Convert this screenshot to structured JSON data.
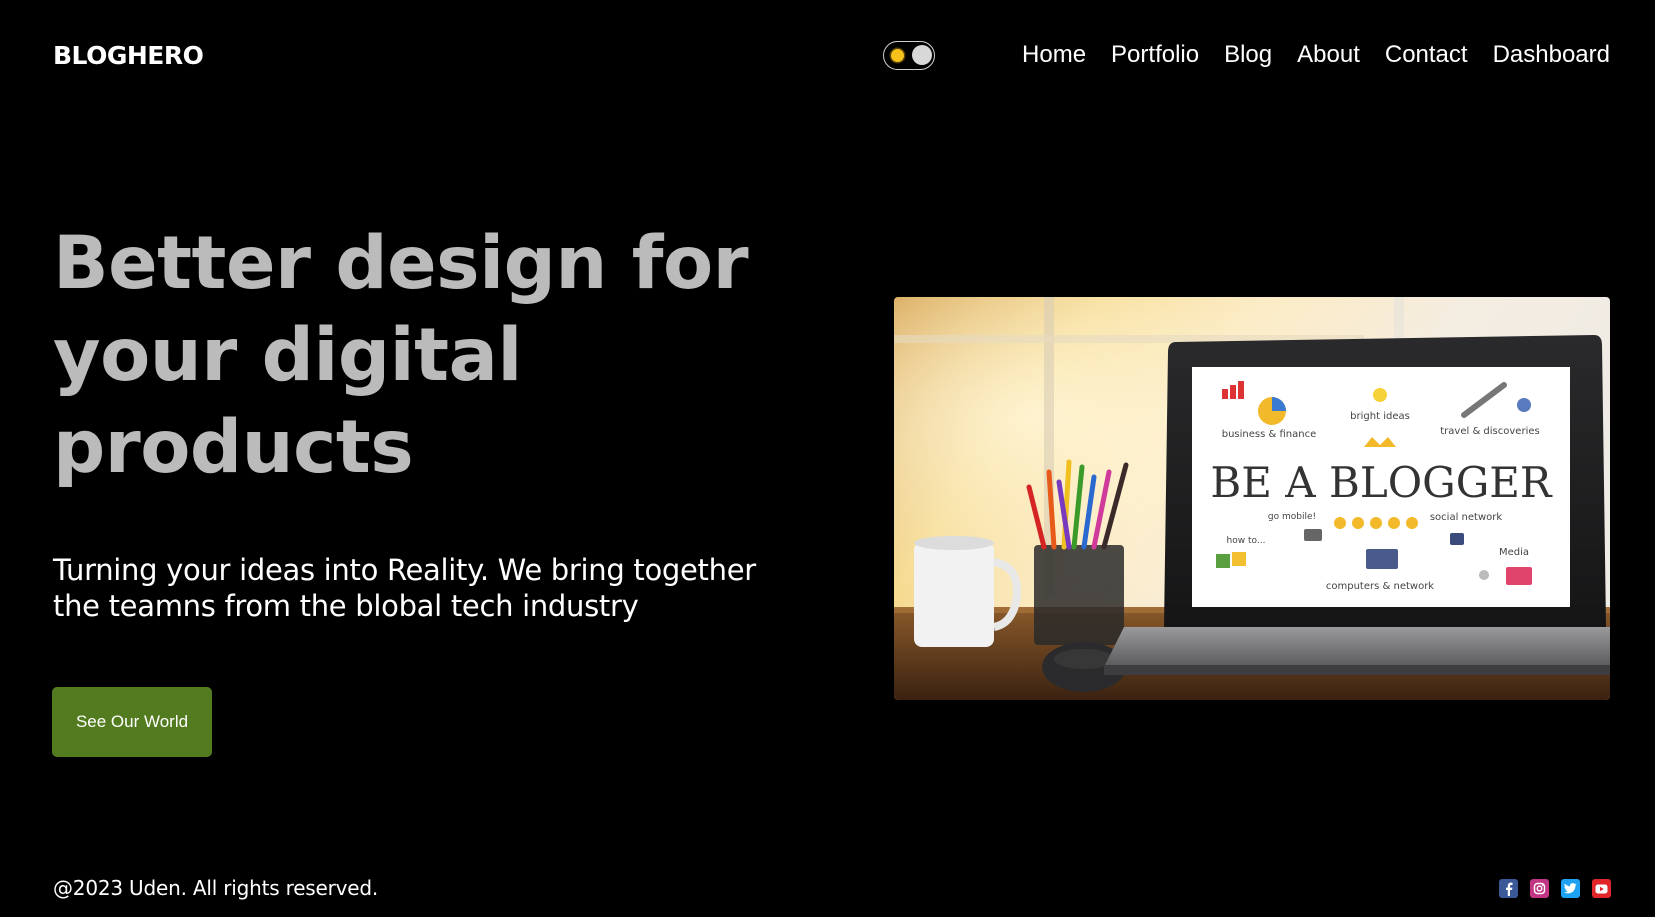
{
  "header": {
    "logo": "BLOGHERO",
    "nav": [
      "Home",
      "Portfolio",
      "Blog",
      "About",
      "Contact",
      "Dashboard"
    ]
  },
  "theme_toggle": {
    "icon": "sun-icon",
    "state": "dark"
  },
  "hero": {
    "title": "Better design for your digital products",
    "subtitle": "Turning your ideas into Reality. We bring together the teamns from the blobal tech industry",
    "cta_label": "See Our World",
    "image": {
      "headline": "BE A BLOGGER",
      "labels": {
        "business": "business & finance",
        "ideas": "bright ideas",
        "travel": "travel & discoveries",
        "mobile": "go mobile!",
        "social": "social network",
        "howto": "how to...",
        "computers": "computers & network",
        "media": "Media"
      }
    }
  },
  "footer": {
    "copyright": "@2023 Uden. All rights reserved.",
    "socials": [
      {
        "name": "facebook-icon",
        "color": "#3b5998"
      },
      {
        "name": "instagram-icon",
        "color": "#c13584"
      },
      {
        "name": "twitter-icon",
        "color": "#1da1f2"
      },
      {
        "name": "youtube-icon",
        "color": "#e0262b"
      }
    ]
  },
  "colors": {
    "background": "#000000",
    "title": "#bbbbbb",
    "accent": "#537b1f",
    "toggle_sun": "#f7c21b"
  }
}
